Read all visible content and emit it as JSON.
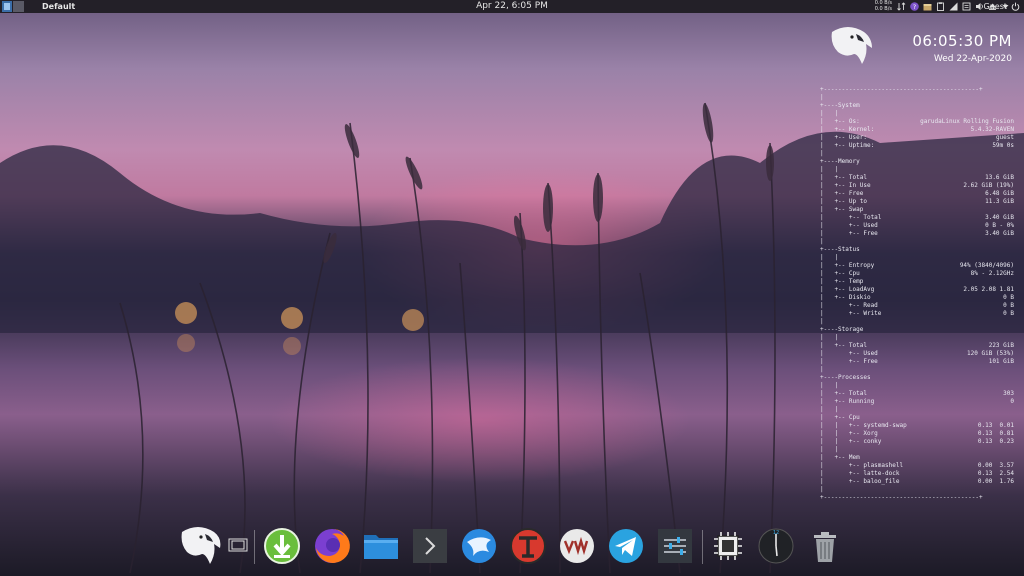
{
  "top_panel": {
    "active_window": "Default",
    "clock": "Apr 22, 6:05 PM",
    "net_down": "0.0 B/s",
    "net_up": "0.0 B/s",
    "user": "Guest",
    "tray_icons": [
      "arrows-updown-icon",
      "help-icon",
      "package-update-icon",
      "clipboard-icon",
      "network-icon",
      "sticky-note-icon",
      "volume-icon",
      "eject-icon"
    ]
  },
  "conky": {
    "time": "06:05:30 PM",
    "date": "Wed 22-Apr-2020",
    "rows": [
      [
        "+-------------------------------------------+",
        ""
      ],
      [
        "|",
        ""
      ],
      [
        "+----System",
        ""
      ],
      [
        "|   |",
        ""
      ],
      [
        "|   +-- Os:",
        "garudaLinux Rolling Fusion"
      ],
      [
        "|   +-- Kernel:",
        "5.4.32-RAVEN"
      ],
      [
        "|   +-- User:",
        "guest"
      ],
      [
        "|   +-- Uptime:",
        "59m 0s"
      ],
      [
        "|",
        ""
      ],
      [
        "+----Memory",
        ""
      ],
      [
        "|   |",
        ""
      ],
      [
        "|   +-- Total",
        "13.6 GiB"
      ],
      [
        "|   +-- In Use",
        "2.62 GiB (19%)"
      ],
      [
        "|   +-- Free",
        "6.48 GiB"
      ],
      [
        "|   +-- Up to",
        "11.3 GiB"
      ],
      [
        "|   +-- Swap",
        ""
      ],
      [
        "|       +-- Total",
        "3.40 GiB"
      ],
      [
        "|       +-- Used",
        "0 B - 0%"
      ],
      [
        "|       +-- Free",
        "3.40 GiB"
      ],
      [
        "|",
        ""
      ],
      [
        "+----Status",
        ""
      ],
      [
        "|   |",
        ""
      ],
      [
        "|   +-- Entropy",
        "94% (3840/4096)"
      ],
      [
        "|   +-- Cpu",
        "8% - 2.12GHz"
      ],
      [
        "|   +-- Temp",
        ""
      ],
      [
        "|   +-- LoadAvg",
        "2.05 2.08 1.81"
      ],
      [
        "|   +-- Diskio",
        "0 B"
      ],
      [
        "|       +-- Read",
        "0 B"
      ],
      [
        "|       +-- Write",
        "0 B"
      ],
      [
        "|",
        ""
      ],
      [
        "+----Storage",
        ""
      ],
      [
        "|   |",
        ""
      ],
      [
        "|   +-- Total",
        "223 GiB"
      ],
      [
        "|       +-- Used",
        "120 GiB (53%)"
      ],
      [
        "|       +-- Free",
        "101 GiB"
      ],
      [
        "|",
        ""
      ],
      [
        "+----Processes",
        ""
      ],
      [
        "|   |",
        ""
      ],
      [
        "|   +-- Total",
        "303"
      ],
      [
        "|   +-- Running",
        "0"
      ],
      [
        "|   |",
        ""
      ],
      [
        "|   +-- Cpu",
        ""
      ],
      [
        "|   |   +-- systemd-swap",
        "0.13  0.01"
      ],
      [
        "|   |   +-- Xorg",
        "0.13  0.81"
      ],
      [
        "|   |   +-- conky",
        "0.13  0.23"
      ],
      [
        "|   |",
        ""
      ],
      [
        "|   +-- Mem",
        ""
      ],
      [
        "|       +-- plasmashell",
        "0.00  3.57"
      ],
      [
        "|       +-- latte-dock",
        "0.13  2.54"
      ],
      [
        "|       +-- baloo_file",
        "0.00  1.76"
      ],
      [
        "|",
        ""
      ],
      [
        "+-------------------------------------------+",
        ""
      ]
    ]
  },
  "dock": {
    "items": [
      {
        "name": "garuda-menu-icon"
      },
      {
        "name": "virtual-desktops-icon"
      },
      {
        "name": "downloader-icon"
      },
      {
        "name": "firefox-icon"
      },
      {
        "name": "file-manager-icon"
      },
      {
        "name": "terminal-icon"
      },
      {
        "name": "garuda-assistant-icon"
      },
      {
        "name": "font-app-icon"
      },
      {
        "name": "virt-manager-icon"
      },
      {
        "name": "telegram-icon"
      },
      {
        "name": "settings-sliders-icon"
      },
      {
        "name": "system-monitor-icon"
      },
      {
        "name": "analog-clock-icon"
      },
      {
        "name": "trash-icon"
      }
    ],
    "colors": {
      "download": "#6abe3c",
      "firefox": "#ff7a1a",
      "files": "#2d8fdd",
      "telegram": "#2aa3e0",
      "fonts": "#d8392e"
    }
  }
}
